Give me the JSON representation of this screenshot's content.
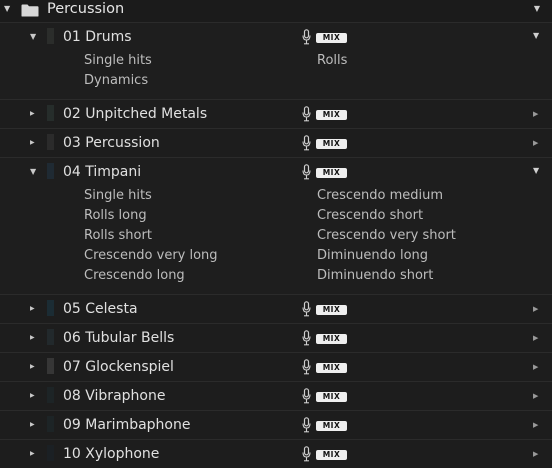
{
  "header": {
    "title": "Percussion"
  },
  "tracks": [
    {
      "name": "01 Drums",
      "expanded": true,
      "swatch": "#2b2d2b",
      "mix_label": "MIX",
      "articulations_left": [
        "Single hits",
        "Dynamics"
      ],
      "articulations_right": [
        "Rolls"
      ]
    },
    {
      "name": "02 Unpitched Metals",
      "expanded": false,
      "swatch": "#262d2b",
      "mix_label": "MIX",
      "articulations_left": [],
      "articulations_right": []
    },
    {
      "name": "03 Percussion",
      "expanded": false,
      "swatch": "#2b2b2b",
      "mix_label": "MIX",
      "articulations_left": [],
      "articulations_right": []
    },
    {
      "name": "04 Timpani",
      "expanded": true,
      "swatch": "#1f2a33",
      "mix_label": "MIX",
      "articulations_left": [
        "Single hits",
        "Rolls long",
        "Rolls short",
        "Crescendo very long",
        "Crescendo long"
      ],
      "articulations_right": [
        "Crescendo medium",
        "Crescendo short",
        "Crescendo very short",
        "Diminuendo long",
        "Diminuendo short"
      ]
    },
    {
      "name": "05 Celesta",
      "expanded": false,
      "swatch": "#1b2c34",
      "mix_label": "MIX",
      "articulations_left": [],
      "articulations_right": []
    },
    {
      "name": "06 Tubular Bells",
      "expanded": false,
      "swatch": "#22292c",
      "mix_label": "MIX",
      "articulations_left": [],
      "articulations_right": []
    },
    {
      "name": "07 Glockenspiel",
      "expanded": false,
      "swatch": "#363636",
      "mix_label": "MIX",
      "articulations_left": [],
      "articulations_right": []
    },
    {
      "name": "08 Vibraphone",
      "expanded": false,
      "swatch": "#1d2426",
      "mix_label": "MIX",
      "articulations_left": [],
      "articulations_right": []
    },
    {
      "name": "09 Marimbaphone",
      "expanded": false,
      "swatch": "#1d2426",
      "mix_label": "MIX",
      "articulations_left": [],
      "articulations_right": []
    },
    {
      "name": "10  Xylophone",
      "expanded": false,
      "swatch": "#1b2024",
      "mix_label": "MIX",
      "articulations_left": [],
      "articulations_right": []
    }
  ],
  "icons": {
    "expanded": "chevron-down-icon",
    "collapsed": "chevron-right-icon",
    "folder": "folder-icon",
    "mic": "microphone-icon"
  },
  "colors": {
    "background": "#1b1b1b",
    "row_border": "#2b2b2b",
    "text": "#e0e0e0",
    "articulation_text": "#bdbdbd",
    "mix_badge_bg": "#efefef",
    "mix_badge_text": "#111111"
  }
}
